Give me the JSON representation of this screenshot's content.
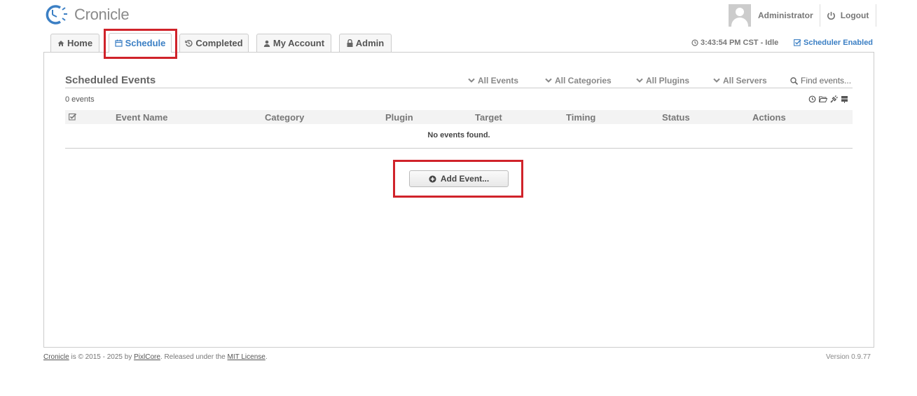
{
  "app": {
    "name": "Cronicle"
  },
  "user": {
    "name": "Administrator",
    "logout_label": "Logout"
  },
  "tabs": [
    {
      "label": "Home",
      "icon": "home-icon"
    },
    {
      "label": "Schedule",
      "icon": "calendar-icon",
      "active": true
    },
    {
      "label": "Completed",
      "icon": "history-icon"
    },
    {
      "label": "My Account",
      "icon": "user-icon"
    },
    {
      "label": "Admin",
      "icon": "lock-icon"
    }
  ],
  "status": {
    "clock": "3:43:54 PM CST - Idle",
    "scheduler": "Scheduler Enabled"
  },
  "schedule": {
    "title": "Scheduled Events",
    "filters": [
      "All Events",
      "All Categories",
      "All Plugins",
      "All Servers"
    ],
    "search_placeholder": "Find events...",
    "count": "0 events",
    "columns": [
      "Event Name",
      "Category",
      "Plugin",
      "Target",
      "Timing",
      "Status",
      "Actions"
    ],
    "empty": "No events found.",
    "add_button": "Add Event..."
  },
  "footer": {
    "brand_link": "Cronicle",
    "text1": " is © 2015 - 2025 by ",
    "company_link": "PixlCore",
    "text2": ". Released under the ",
    "license_link": "MIT License",
    "text3": ".",
    "version": "Version 0.9.77"
  },
  "colors": {
    "accent": "#3b7fc4",
    "highlight": "#d0232a"
  }
}
